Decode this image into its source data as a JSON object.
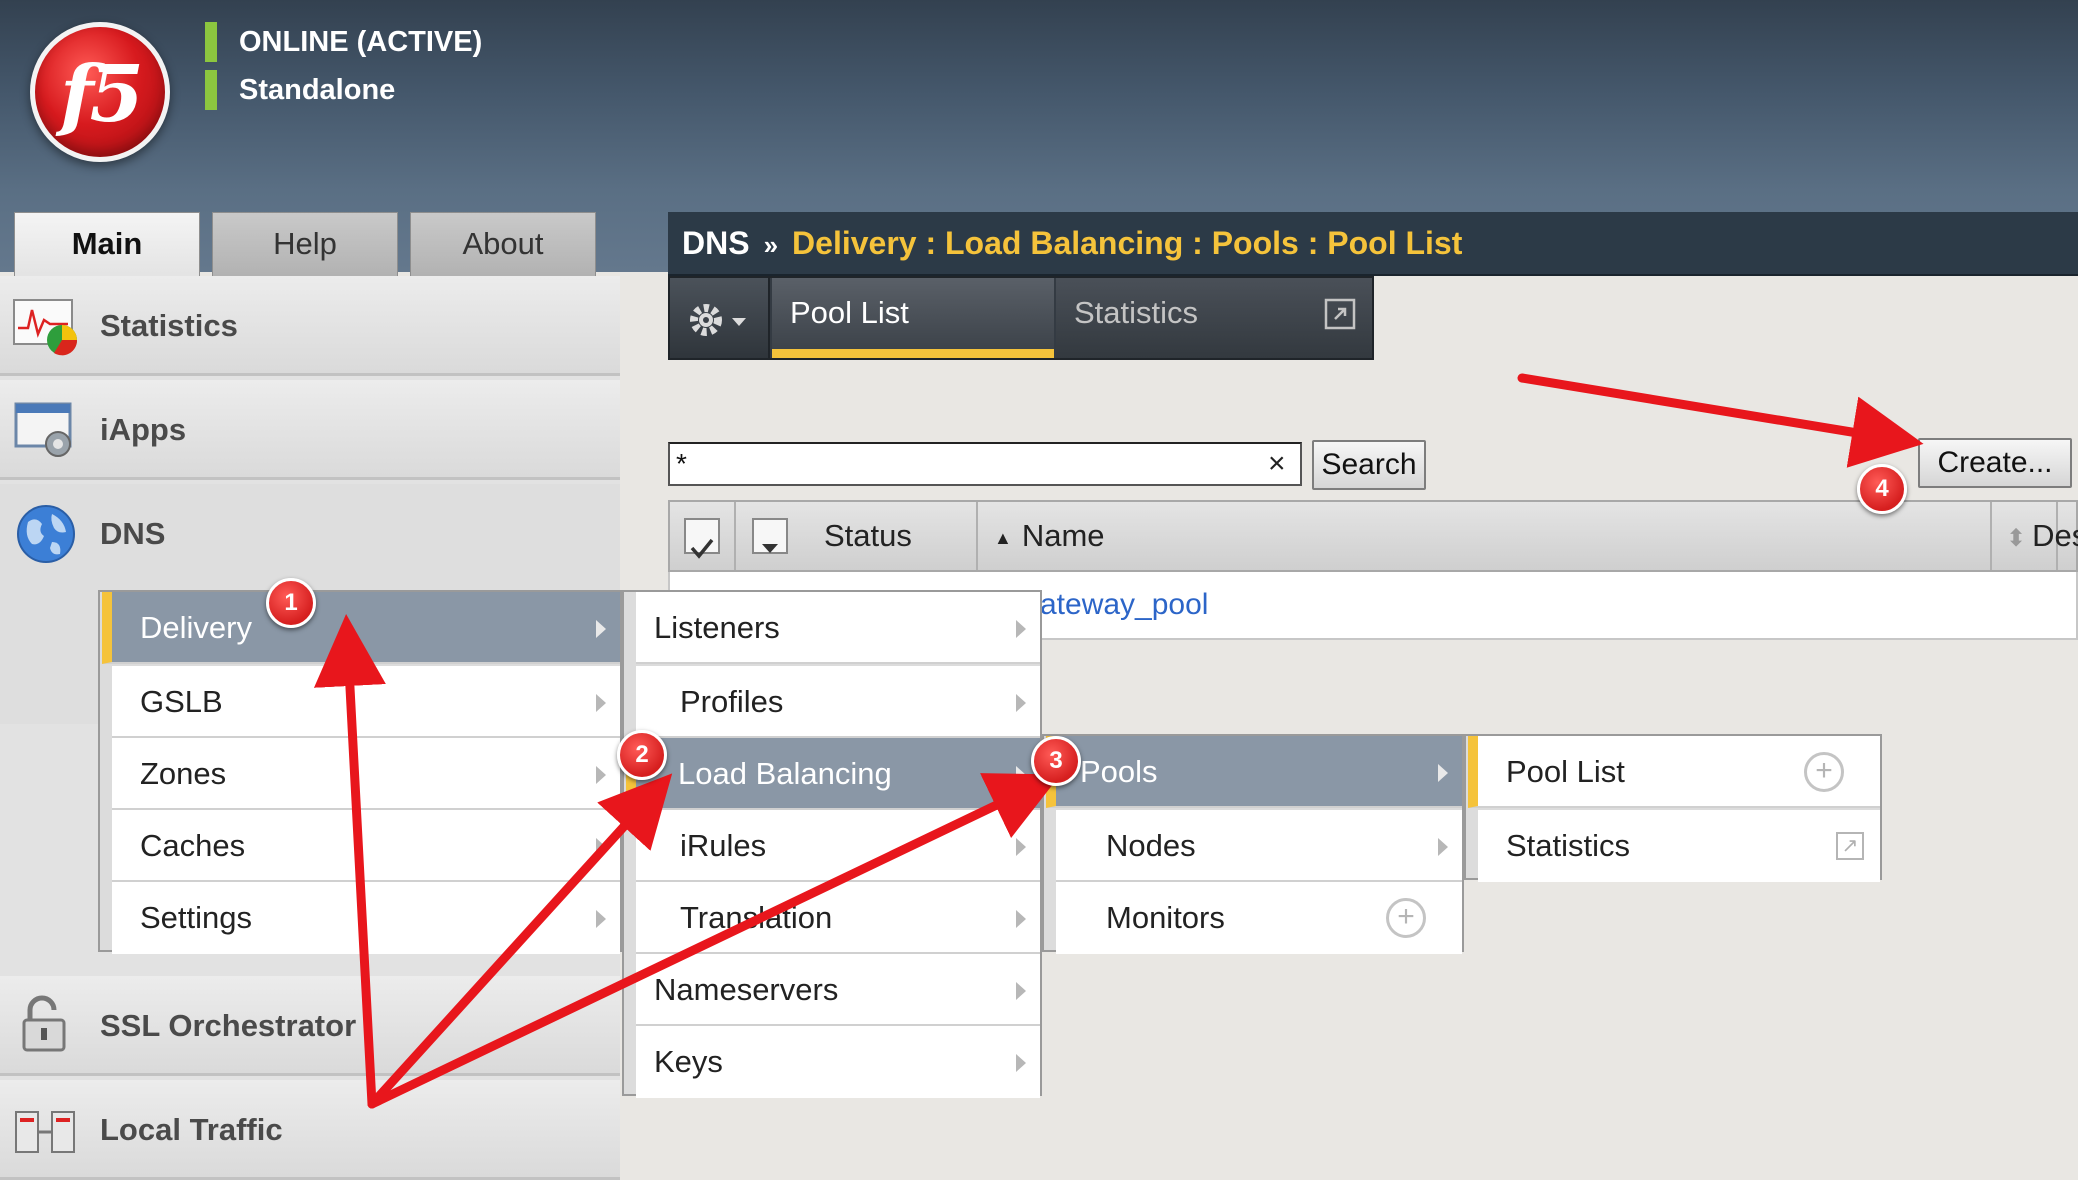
{
  "header": {
    "logo_text": "f5",
    "status_active": "ONLINE (ACTIVE)",
    "status_mode": "Standalone"
  },
  "tabs": [
    "Main",
    "Help",
    "About"
  ],
  "sidebar": {
    "sections": [
      {
        "label": "Statistics",
        "icon": "statistics-icon"
      },
      {
        "label": "iApps",
        "icon": "iapps-icon"
      },
      {
        "label": "DNS",
        "icon": "globe-icon"
      },
      {
        "label": "SSL Orchestrator",
        "icon": "lock-icon"
      },
      {
        "label": "Local Traffic",
        "icon": "servers-icon"
      }
    ]
  },
  "breadcrumb": {
    "root": "DNS",
    "separator": "»",
    "path": "Delivery : Load Balancing : Pools : Pool List"
  },
  "subtabs": {
    "pool_list": "Pool List",
    "statistics": "Statistics"
  },
  "search": {
    "value": "*",
    "clear": "×",
    "button": "Search"
  },
  "create_button": "Create...",
  "table": {
    "columns": [
      "Status",
      "Name",
      "Des"
    ],
    "sort_asc": "▲",
    "sort_both": "⬍",
    "rows": [
      {
        "name": "ateway_pool"
      }
    ]
  },
  "menus": {
    "dns": [
      "Delivery",
      "GSLB",
      "Zones",
      "Caches",
      "Settings"
    ],
    "delivery": [
      "Listeners",
      "Profiles",
      "Load Balancing",
      "iRules",
      "Translation",
      "Nameservers",
      "Keys"
    ],
    "load_balancing": [
      "Pools",
      "Nodes",
      "Monitors"
    ],
    "pools": [
      "Pool List",
      "Statistics"
    ]
  },
  "badges": [
    "1",
    "2",
    "3",
    "4"
  ],
  "colors": {
    "accent_yellow": "#f5c33b",
    "status_green": "#8cc63f",
    "annotation_red": "#e8161c",
    "link_blue": "#2c65c8"
  }
}
